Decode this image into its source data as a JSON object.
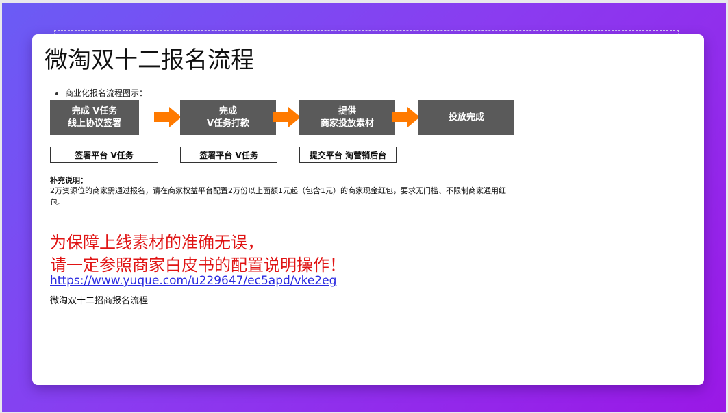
{
  "slide": {
    "title": "微淘双十二报名流程",
    "bullet": "商业化报名流程图示：",
    "steps": [
      {
        "label": "完成 V任务\n线上协议签署"
      },
      {
        "label": "完成\nV任务打款"
      },
      {
        "label": "提供\n商家投放素材"
      },
      {
        "label": "投放完成"
      }
    ],
    "platforms": [
      {
        "label": "签署平台 V任务"
      },
      {
        "label": "签署平台 V任务"
      },
      {
        "label": "提交平台 淘营销后台"
      }
    ],
    "note": {
      "title": "补充说明：",
      "body": "2万资源位的商家需通过报名，请在商家权益平台配置2万份以上面额1元起（包含1元）的商家现金红包，要求无门槛、不限制商家通用红包。"
    },
    "warning_line1": "为保障上线素材的准确无误，",
    "warning_line2": "请一定参照商家白皮书的配置说明操作！",
    "link_text": "https://www.yuque.com/u229647/ec5apd/vke2eg",
    "footer_label": "微淘双十二招商报名流程"
  },
  "colors": {
    "step_fill": "#5a5a5a",
    "arrow": "#ff7a00",
    "warning": "#e01414",
    "link": "#2a2ae0",
    "background_start": "#6a5cf5",
    "background_end": "#9a18e6"
  },
  "icons": {
    "arrow": "right-arrow-icon"
  }
}
